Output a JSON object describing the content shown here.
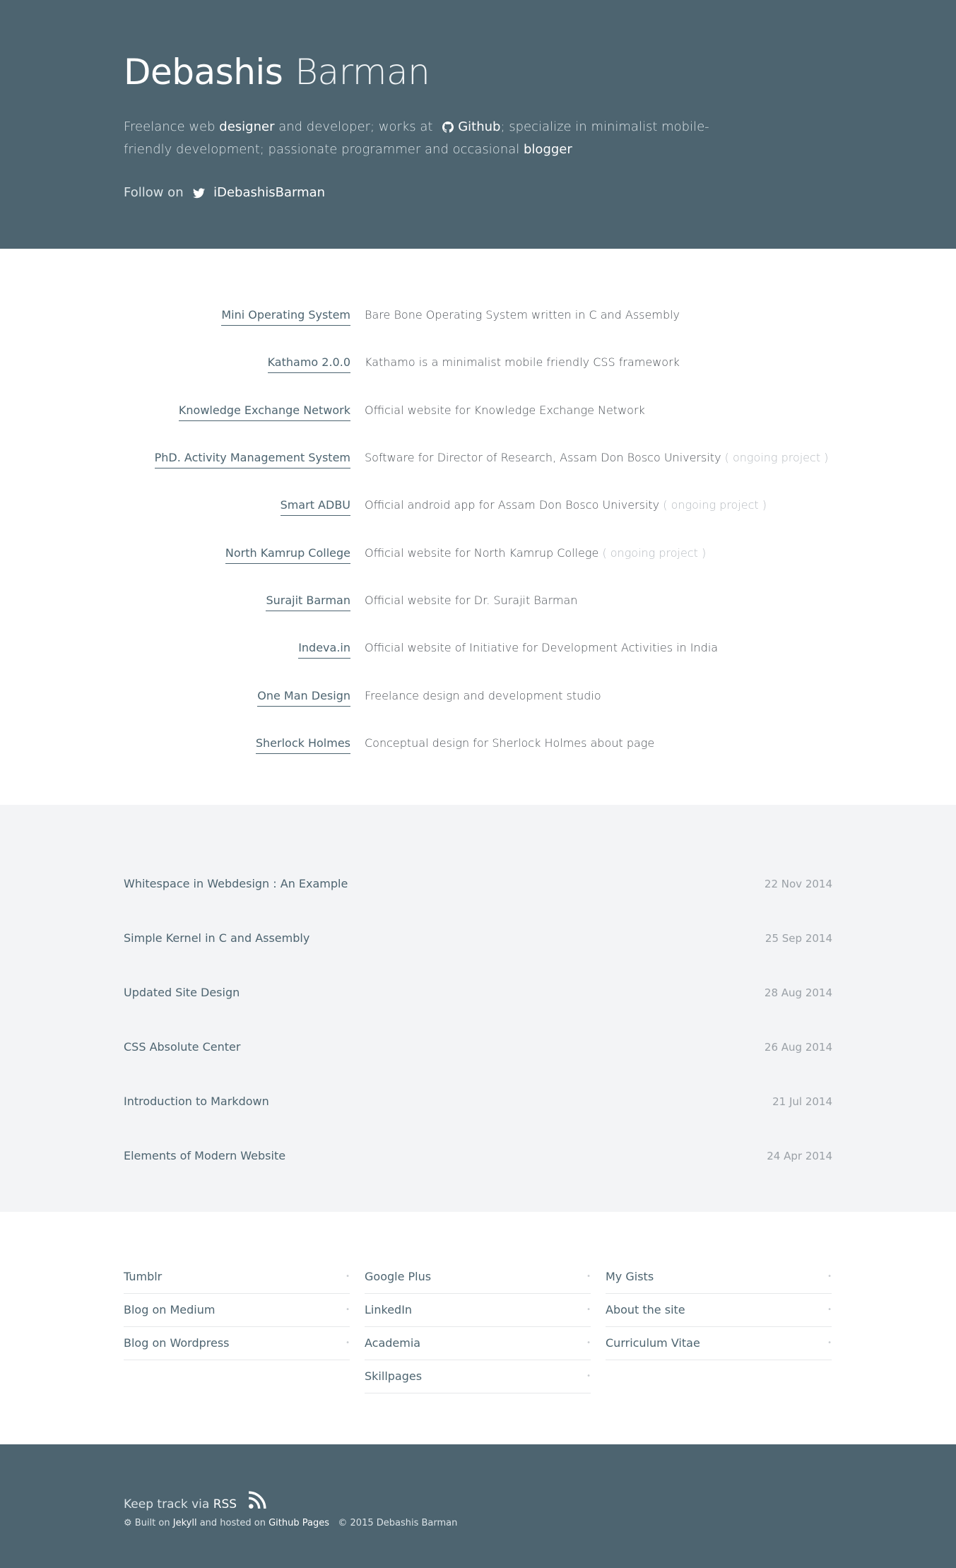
{
  "header": {
    "first_name": "Debashis",
    "last_name": "Barman",
    "bio_1": "Freelance web",
    "bio_designer": "designer",
    "bio_2": "and developer; works at",
    "bio_github": "Github",
    "bio_3": "; specialize in minimalist mobile-friendly development; passionate programmer and occasional",
    "bio_blogger": "blogger",
    "follow_label": "Follow on",
    "twitter_handle": "iDebashisBarman"
  },
  "projects": [
    {
      "name": "Mini Operating System",
      "description": "Bare Bone Operating System written in C and Assembly",
      "note": ""
    },
    {
      "name": "Kathamo 2.0.0",
      "description": "Kathamo is a minimalist mobile friendly CSS framework",
      "note": ""
    },
    {
      "name": "Knowledge Exchange Network",
      "description": "Official website for Knowledge Exchange Network",
      "note": ""
    },
    {
      "name": "PhD. Activity Management System",
      "description": "Software for Director of Research, Assam Don Bosco University",
      "note": "( ongoing project )"
    },
    {
      "name": "Smart ADBU",
      "description": "Official android app for Assam Don Bosco University",
      "note": "( ongoing project )"
    },
    {
      "name": "North Kamrup College",
      "description": "Official website for North Kamrup College",
      "note": "( ongoing project )"
    },
    {
      "name": "Surajit Barman",
      "description": "Official website for Dr. Surajit Barman",
      "note": ""
    },
    {
      "name": "Indeva.in",
      "description": "Official website of Initiative for Development Activities in India",
      "note": ""
    },
    {
      "name": "One Man Design",
      "description": "Freelance design and development studio",
      "note": ""
    },
    {
      "name": "Sherlock Holmes",
      "description": "Conceptual design for Sherlock Holmes about page",
      "note": ""
    }
  ],
  "posts": [
    {
      "title": "Whitespace in Webdesign : An Example",
      "date": "22 Nov 2014"
    },
    {
      "title": "Simple Kernel in C and Assembly",
      "date": "25 Sep 2014"
    },
    {
      "title": "Updated Site Design",
      "date": "28 Aug 2014"
    },
    {
      "title": "CSS Absolute Center",
      "date": "26 Aug 2014"
    },
    {
      "title": "Introduction to Markdown",
      "date": "21 Jul 2014"
    },
    {
      "title": "Elements of Modern Website",
      "date": "24 Apr 2014"
    }
  ],
  "links": {
    "col1": [
      "Tumblr",
      "Blog on Medium",
      "Blog on Wordpress"
    ],
    "col2": [
      "Google Plus",
      "LinkedIn",
      "Academia",
      "Skillpages"
    ],
    "col3": [
      "My Gists",
      "About the site",
      "Curriculum Vitae"
    ],
    "bullet": "•"
  },
  "footer": {
    "track_label": "Keep track via",
    "rss": "RSS",
    "built_on": "Built on",
    "jekyll": "Jekyll",
    "hosted_on": "and hosted on",
    "github_pages": "Github Pages",
    "copyright": "© 2015 Debashis Barman"
  },
  "colors": {
    "header_bg": "#4d6470",
    "posts_bg": "#f3f4f6",
    "link": "#4d6470",
    "muted": "#9aa0a6"
  },
  "icons": [
    "github-icon",
    "twitter-icon",
    "rss-icon",
    "gear-icon"
  ]
}
